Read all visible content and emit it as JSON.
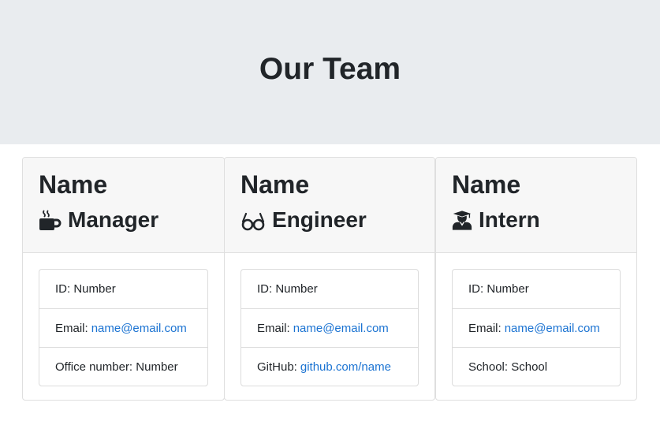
{
  "header": {
    "title": "Our Team"
  },
  "cards": [
    {
      "name": "Name",
      "role": "Manager",
      "icon": "coffee-mug-icon",
      "id_label": "ID:",
      "id_value": "Number",
      "email_label": "Email:",
      "email_value": "name@email.com",
      "extra_label": "Office number:",
      "extra_value": "Number"
    },
    {
      "name": "Name",
      "role": "Engineer",
      "icon": "glasses-icon",
      "id_label": "ID:",
      "id_value": "Number",
      "email_label": "Email:",
      "email_value": "name@email.com",
      "extra_label": "GitHub:",
      "extra_value": "github.com/name"
    },
    {
      "name": "Name",
      "role": "Intern",
      "icon": "graduate-icon",
      "id_label": "ID:",
      "id_value": "Number",
      "email_label": "Email:",
      "email_value": "name@email.com",
      "extra_label": "School:",
      "extra_value": "School"
    }
  ],
  "colors": {
    "link": "#1b73d2",
    "header_bg": "#e9ecef",
    "card_header_bg": "#f7f7f7"
  }
}
